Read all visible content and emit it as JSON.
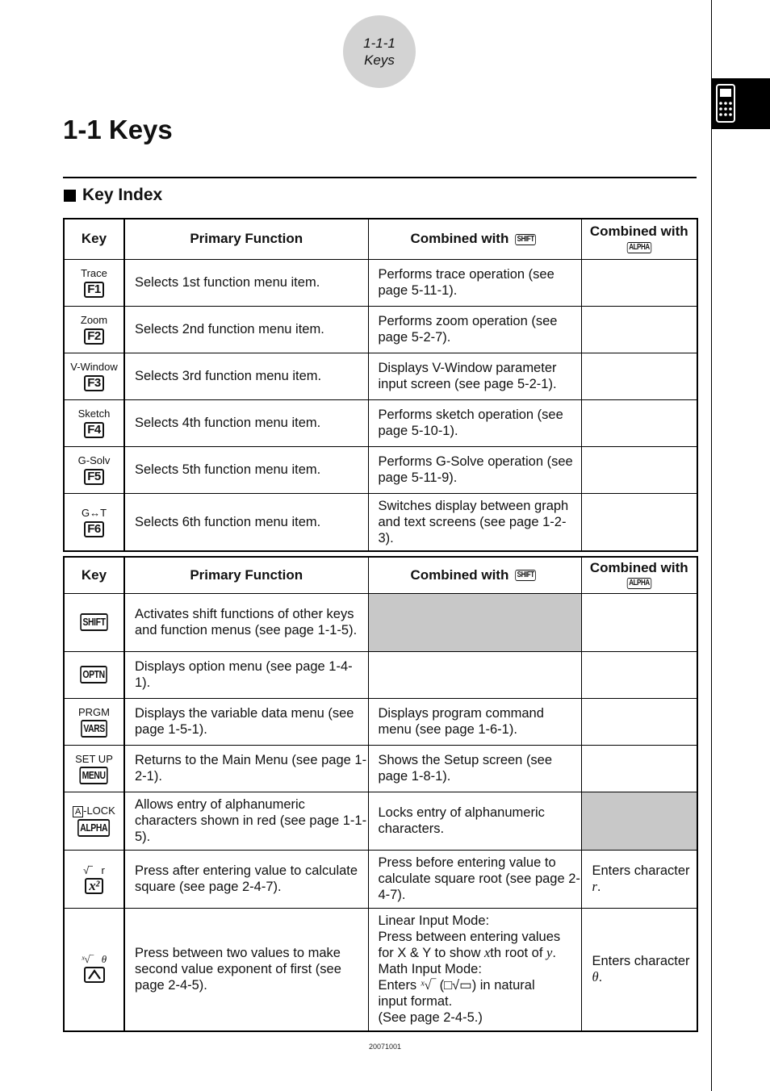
{
  "page_badge": {
    "number": "1-1-1",
    "label": "Keys"
  },
  "side_tab": {
    "icon": "calculator-icon"
  },
  "title": "1-1 Keys",
  "section_heading": "Key Index",
  "table_headers": {
    "key": "Key",
    "primary": "Primary Function",
    "shift": "Combined with",
    "shift_key": "SHIFT",
    "alpha": "Combined with",
    "alpha_key": "ALPHA"
  },
  "table1": [
    {
      "label": "Trace",
      "key": "F1",
      "primary": "Selects 1st function menu item.",
      "shift": "Performs trace operation (see page 5-11-1).",
      "alpha": ""
    },
    {
      "label": "Zoom",
      "key": "F2",
      "primary": "Selects 2nd function menu item.",
      "shift": "Performs zoom operation (see page 5-2-7).",
      "alpha": ""
    },
    {
      "label": "V-Window",
      "key": "F3",
      "primary": "Selects 3rd function menu item.",
      "shift": "Displays V-Window parameter input screen (see page 5-2-1).",
      "alpha": ""
    },
    {
      "label": "Sketch",
      "key": "F4",
      "primary": "Selects 4th function menu item.",
      "shift": "Performs sketch operation (see page 5-10-1).",
      "alpha": ""
    },
    {
      "label": "G-Solv",
      "key": "F5",
      "primary": "Selects 5th function menu item.",
      "shift": "Performs G-Solve operation (see page 5-11-9).",
      "alpha": ""
    },
    {
      "label": "G↔T",
      "key": "F6",
      "primary": "Selects 6th function menu item.",
      "shift": "Switches display between graph and text screens (see page 1-2-3).",
      "alpha": ""
    }
  ],
  "table2": [
    {
      "label": "",
      "key": "SHIFT",
      "primary": "Activates shift functions of other keys and function menus (see page 1-1-5).",
      "shift": "",
      "shift_shaded": true,
      "alpha": ""
    },
    {
      "label": "",
      "key": "OPTN",
      "primary": "Displays option menu (see page 1-4-1).",
      "shift": "",
      "alpha": ""
    },
    {
      "label": "PRGM",
      "key": "VARS",
      "primary": "Displays the variable data menu (see page 1-5-1).",
      "shift": "Displays program command menu (see page 1-6-1).",
      "alpha": ""
    },
    {
      "label": "SET UP",
      "key": "MENU",
      "primary": "Returns to the Main Menu (see page 1-2-1).",
      "shift": "Shows the Setup screen (see page 1-8-1).",
      "alpha": ""
    },
    {
      "label_box": "A",
      "label": "-LOCK",
      "key": "ALPHA",
      "primary": "Allows entry of alphanumeric characters shown in red (see page 1-1-5).",
      "shift": "Locks entry of alphanumeric characters.",
      "alpha": "",
      "alpha_shaded": true
    },
    {
      "label": "√‾   r",
      "key": "x²",
      "primary": "Press after entering value to calculate square (see page 2-4-7).",
      "shift": "Press before entering value to calculate square root (see page 2-4-7).",
      "alpha_prefix": "Enters character ",
      "alpha_var": "r",
      "alpha_suffix": "."
    },
    {
      "label": "ˣ√‾   θ",
      "key": "^",
      "primary": "Press between two values to make second value exponent of first (see page 2-4-5).",
      "shift_lines": {
        "l1": "Linear Input Mode:",
        "l2": "Press between entering values",
        "l3a": "for X & Y to show ",
        "l3x": "x",
        "l3b": "th root of ",
        "l3y": "y",
        "l3c": ".",
        "l4": "Math Input Mode:",
        "l5a": "Enters ",
        "l5sym": "ˣ√‾",
        "l5b": " (□√▭) in natural",
        "l6": "input format.",
        "l7": "(See page 2-4-5.)"
      },
      "alpha_prefix": "Enters character ",
      "alpha_var": "θ",
      "alpha_suffix": "."
    }
  ],
  "footer_code": "20071001"
}
